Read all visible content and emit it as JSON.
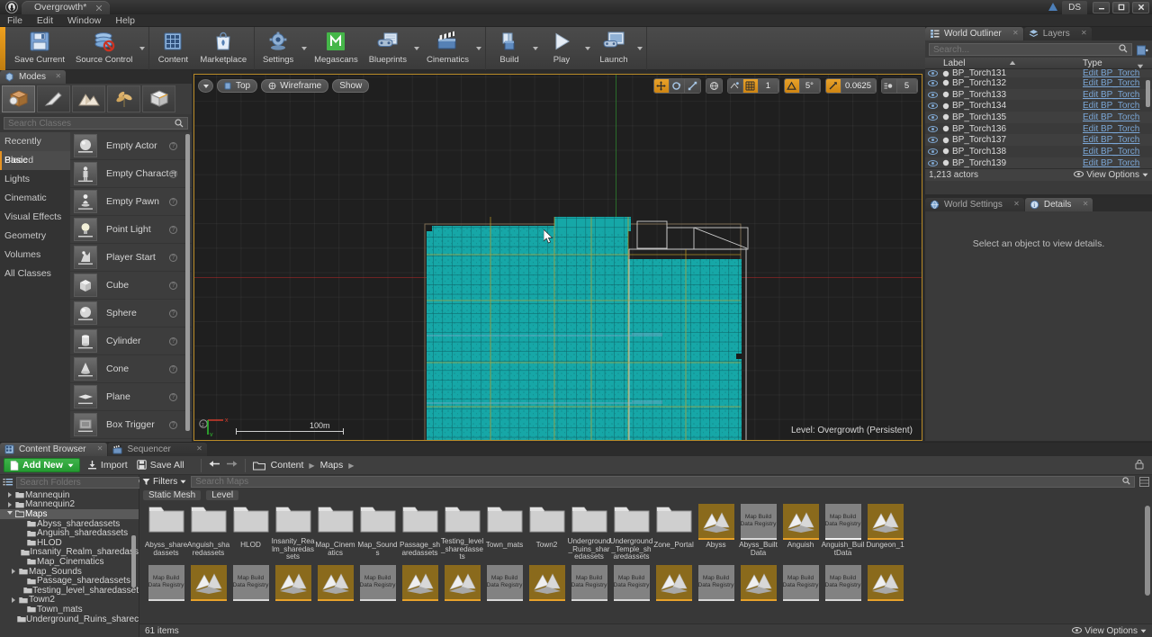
{
  "titlebar": {
    "project_tab": "Overgrowth*",
    "user_badge": "DS",
    "window_buttons": [
      "minimize",
      "maximize",
      "close"
    ]
  },
  "menubar": {
    "items": [
      "File",
      "Edit",
      "Window",
      "Help"
    ]
  },
  "toolbar": {
    "groups": [
      {
        "items": [
          {
            "label": "Save Current",
            "icon": "save-icon",
            "arrow": false
          },
          {
            "label": "Source Control",
            "icon": "source-control-icon",
            "arrow": true
          }
        ]
      },
      {
        "items": [
          {
            "label": "Content",
            "icon": "content-icon",
            "arrow": false
          },
          {
            "label": "Marketplace",
            "icon": "marketplace-icon",
            "arrow": false
          }
        ]
      },
      {
        "items": [
          {
            "label": "Settings",
            "icon": "settings-icon",
            "arrow": true
          },
          {
            "label": "Megascans",
            "icon": "megascans-icon",
            "arrow": false
          },
          {
            "label": "Blueprints",
            "icon": "blueprints-icon",
            "arrow": true
          },
          {
            "label": "Cinematics",
            "icon": "cinematics-icon",
            "arrow": true
          }
        ]
      },
      {
        "items": [
          {
            "label": "Build",
            "icon": "build-icon",
            "arrow": true
          },
          {
            "label": "Play",
            "icon": "play-icon",
            "arrow": true
          },
          {
            "label": "Launch",
            "icon": "launch-icon",
            "arrow": true
          }
        ]
      }
    ]
  },
  "modes": {
    "tab_label": "Modes",
    "mode_buttons": [
      "place-mode-icon",
      "paint-mode-icon",
      "landscape-mode-icon",
      "foliage-mode-icon",
      "geometry-editing-mode-icon"
    ],
    "search_placeholder": "Search Classes",
    "categories": [
      {
        "label": "Recently Placed",
        "active": false,
        "hover": true
      },
      {
        "label": "Basic",
        "active": true,
        "hover": false
      },
      {
        "label": "Lights",
        "active": false,
        "hover": false
      },
      {
        "label": "Cinematic",
        "active": false,
        "hover": false
      },
      {
        "label": "Visual Effects",
        "active": false,
        "hover": false
      },
      {
        "label": "Geometry",
        "active": false,
        "hover": false
      },
      {
        "label": "Volumes",
        "active": false,
        "hover": false
      },
      {
        "label": "All Classes",
        "active": false,
        "hover": false
      }
    ],
    "placeables": [
      {
        "label": "Empty Actor",
        "icon": "sphere-thumb"
      },
      {
        "label": "Empty Character",
        "icon": "character-thumb"
      },
      {
        "label": "Empty Pawn",
        "icon": "pawn-thumb"
      },
      {
        "label": "Point Light",
        "icon": "bulb-thumb"
      },
      {
        "label": "Player Start",
        "icon": "player-start-thumb"
      },
      {
        "label": "Cube",
        "icon": "cube-thumb"
      },
      {
        "label": "Sphere",
        "icon": "sphere-thumb"
      },
      {
        "label": "Cylinder",
        "icon": "cylinder-thumb"
      },
      {
        "label": "Cone",
        "icon": "cone-thumb"
      },
      {
        "label": "Plane",
        "icon": "plane-thumb"
      },
      {
        "label": "Box Trigger",
        "icon": "box-trigger-thumb"
      }
    ]
  },
  "viewport": {
    "left_buttons": [
      {
        "label": "",
        "icon": "viewport-options-caret",
        "type": "round"
      },
      {
        "label": "Top",
        "icon": "camera-icon",
        "type": "pill"
      },
      {
        "label": "Wireframe",
        "icon": "viewmode-icon",
        "type": "pill"
      },
      {
        "label": "Show",
        "icon": "",
        "type": "pill"
      }
    ],
    "right_controls": {
      "transform_tools": [
        "translate-icon",
        "rotate-icon",
        "scale-icon"
      ],
      "coordinate_system": "world-coords-icon",
      "surface_snap": "surface-snap-icon",
      "grid_snap_on": true,
      "grid_snap_value": "1",
      "rotation_snap_on": true,
      "rotation_snap_value": "5°",
      "scale_snap_on": true,
      "scale_snap_value": "0.0625",
      "camera_speed_value": "5"
    },
    "scale_bar_label": "100m",
    "axis_x_label": "x",
    "axis_y_label": "y",
    "level_label": "Level:  Overgrowth (Persistent)"
  },
  "outliner": {
    "tabs": [
      {
        "label": "World Outliner",
        "active": true,
        "icon": "outliner-icon"
      },
      {
        "label": "Layers",
        "active": false,
        "icon": "layers-icon"
      }
    ],
    "search_placeholder": "Search...",
    "columns": [
      "Label",
      "Type"
    ],
    "rows": [
      {
        "label": "BP_Torch131",
        "type": "Edit BP_Torch"
      },
      {
        "label": "BP_Torch132",
        "type": "Edit BP_Torch"
      },
      {
        "label": "BP_Torch133",
        "type": "Edit BP_Torch"
      },
      {
        "label": "BP_Torch134",
        "type": "Edit BP_Torch"
      },
      {
        "label": "BP_Torch135",
        "type": "Edit BP_Torch"
      },
      {
        "label": "BP_Torch136",
        "type": "Edit BP_Torch"
      },
      {
        "label": "BP_Torch137",
        "type": "Edit BP_Torch"
      },
      {
        "label": "BP_Torch138",
        "type": "Edit BP_Torch"
      },
      {
        "label": "BP_Torch139",
        "type": "Edit BP_Torch"
      }
    ],
    "actor_count": "1,213 actors",
    "view_options": "View Options"
  },
  "details": {
    "tabs": [
      {
        "label": "World Settings",
        "active": false,
        "icon": "world-settings-icon"
      },
      {
        "label": "Details",
        "active": true,
        "icon": "details-icon"
      }
    ],
    "empty_message": "Select an object to view details."
  },
  "content_browser": {
    "tabs": [
      {
        "label": "Content Browser",
        "active": true,
        "icon": "content-browser-icon"
      },
      {
        "label": "Sequencer",
        "active": false,
        "icon": "sequencer-icon"
      }
    ],
    "add_new_label": "Add New",
    "import_label": "Import",
    "save_all_label": "Save All",
    "breadcrumb": [
      "Content",
      "Maps"
    ],
    "folder_search_placeholder": "Search Folders",
    "asset_search_placeholder": "Search Maps",
    "filters_label": "Filters",
    "filter_chips": [
      "Static Mesh",
      "Level"
    ],
    "folder_tree": [
      {
        "label": "Mannequin",
        "depth": 1,
        "arrow": "closed",
        "selected": false
      },
      {
        "label": "Mannequin2",
        "depth": 1,
        "arrow": "closed",
        "selected": false
      },
      {
        "label": "Maps",
        "depth": 1,
        "arrow": "open",
        "selected": true
      },
      {
        "label": "Abyss_sharedassets",
        "depth": 2,
        "arrow": "none",
        "selected": false
      },
      {
        "label": "Anguish_sharedassets",
        "depth": 2,
        "arrow": "none",
        "selected": false
      },
      {
        "label": "HLOD",
        "depth": 2,
        "arrow": "none",
        "selected": false
      },
      {
        "label": "Insanity_Realm_sharedass",
        "depth": 2,
        "arrow": "none",
        "selected": false
      },
      {
        "label": "Map_Cinematics",
        "depth": 2,
        "arrow": "none",
        "selected": false
      },
      {
        "label": "Map_Sounds",
        "depth": 2,
        "arrow": "closed",
        "selected": false
      },
      {
        "label": "Passage_sharedassets",
        "depth": 2,
        "arrow": "none",
        "selected": false
      },
      {
        "label": "Testing_level_sharedasset",
        "depth": 2,
        "arrow": "none",
        "selected": false
      },
      {
        "label": "Town2",
        "depth": 2,
        "arrow": "closed",
        "selected": false
      },
      {
        "label": "Town_mats",
        "depth": 2,
        "arrow": "none",
        "selected": false
      },
      {
        "label": "Underground_Ruins_sharec",
        "depth": 2,
        "arrow": "none",
        "selected": false
      }
    ],
    "assets_row1": [
      {
        "name": "Abyss_sharedassets",
        "kind": "folder"
      },
      {
        "name": "Anguish_sharedassets",
        "kind": "folder"
      },
      {
        "name": "HLOD",
        "kind": "folder"
      },
      {
        "name": "Insanity_Realm_sharedassets",
        "kind": "folder"
      },
      {
        "name": "Map_Cinematics",
        "kind": "folder"
      },
      {
        "name": "Map_Sounds",
        "kind": "folder"
      },
      {
        "name": "Passage_sharedassets",
        "kind": "folder"
      },
      {
        "name": "Testing_level_sharedassets",
        "kind": "folder"
      },
      {
        "name": "Town_mats",
        "kind": "folder"
      },
      {
        "name": "Town2",
        "kind": "folder"
      },
      {
        "name": "Underground_Ruins_sharedassets",
        "kind": "folder"
      },
      {
        "name": "Underground_Temple_sharedassets",
        "kind": "folder"
      },
      {
        "name": "Zone_Portal",
        "kind": "folder"
      },
      {
        "name": "Abyss",
        "kind": "level"
      },
      {
        "name": "Abyss_Built Data",
        "kind": "mapbuild",
        "thumb_label": "Map Build Data Registry"
      },
      {
        "name": "Anguish",
        "kind": "level"
      },
      {
        "name": "Anguish_BuiltData",
        "kind": "mapbuild",
        "thumb_label": "Map Build Data Registry"
      },
      {
        "name": "Dungeon_1",
        "kind": "level"
      }
    ],
    "assets_row2": [
      {
        "kind": "mapbuild",
        "thumb_label": "Map Build Data Registry"
      },
      {
        "kind": "level"
      },
      {
        "kind": "mapbuild",
        "thumb_label": "Map Build Data Registry"
      },
      {
        "kind": "level"
      },
      {
        "kind": "level"
      },
      {
        "kind": "mapbuild",
        "thumb_label": "Map Build Data Registry"
      },
      {
        "kind": "level"
      },
      {
        "kind": "level"
      },
      {
        "kind": "mapbuild",
        "thumb_label": "Map Build Data Registry"
      },
      {
        "kind": "level"
      },
      {
        "kind": "mapbuild",
        "thumb_label": "Map Build Data Registry"
      },
      {
        "kind": "mapbuild",
        "thumb_label": "Map Build Data Registry"
      },
      {
        "kind": "level"
      },
      {
        "kind": "mapbuild",
        "thumb_label": "Map Build Data Registry"
      },
      {
        "kind": "level"
      },
      {
        "kind": "mapbuild",
        "thumb_label": "Map Build Data Registry"
      },
      {
        "kind": "mapbuild",
        "thumb_label": "Map Build Data Registry"
      },
      {
        "kind": "level"
      }
    ],
    "item_count": "61 items",
    "view_options": "View Options"
  },
  "colors": {
    "accent_orange": "#e8a22b",
    "wireframe_cyan": "#19b4b4",
    "green_button": "#2fa83c",
    "link_blue": "#7ba7d7"
  }
}
